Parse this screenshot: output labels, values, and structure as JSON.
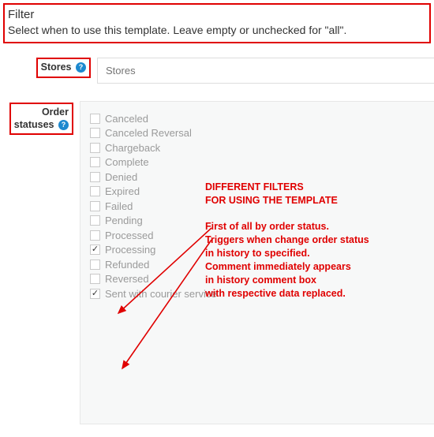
{
  "filter": {
    "title": "Filter",
    "subtitle": "Select when to use this template. Leave empty or unchecked for \"all\"."
  },
  "stores": {
    "label": "Stores",
    "placeholder": "Stores"
  },
  "statuses": {
    "label_line1": "Order",
    "label_line2": "statuses",
    "items": [
      {
        "label": "Canceled",
        "checked": false
      },
      {
        "label": "Canceled Reversal",
        "checked": false
      },
      {
        "label": "Chargeback",
        "checked": false
      },
      {
        "label": "Complete",
        "checked": false
      },
      {
        "label": "Denied",
        "checked": false
      },
      {
        "label": "Expired",
        "checked": false
      },
      {
        "label": "Failed",
        "checked": false
      },
      {
        "label": "Pending",
        "checked": false
      },
      {
        "label": "Processed",
        "checked": false
      },
      {
        "label": "Processing",
        "checked": true
      },
      {
        "label": "Refunded",
        "checked": false
      },
      {
        "label": "Reversed",
        "checked": false
      },
      {
        "label": "Sent with courier service",
        "checked": true
      }
    ]
  },
  "annotations": {
    "heading1": "DIFFERENT FILTERS",
    "heading2": "FOR USING THE TEMPLATE",
    "body1": "First of all by order status.",
    "body2": "Triggers when change order status",
    "body3": "in history to specified.",
    "body4": "Comment immediately appears",
    "body5": "in history comment box",
    "body6": "with respective data replaced."
  },
  "colors": {
    "accent_red": "#e00000",
    "help_blue": "#1d89cf"
  }
}
